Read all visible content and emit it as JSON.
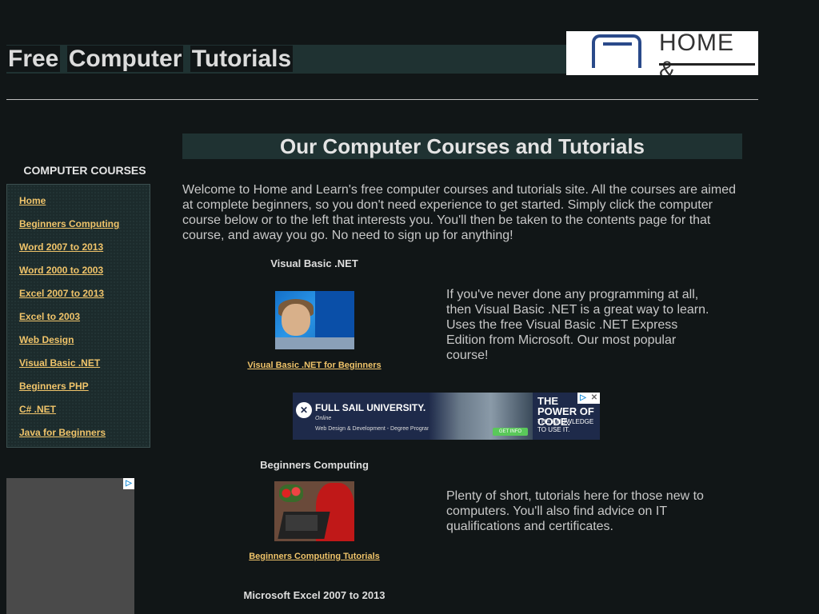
{
  "header": {
    "title_words": [
      "Free",
      "Computer",
      "Tutorials"
    ],
    "logo_text": "HOME &"
  },
  "sidebar": {
    "heading": "COMPUTER COURSES",
    "items": [
      {
        "label": "Home"
      },
      {
        "label": "Beginners Computing"
      },
      {
        "label": "Word 2007 to 2013"
      },
      {
        "label": "Word 2000 to 2003"
      },
      {
        "label": "Excel 2007 to 2013"
      },
      {
        "label": "Excel to 2003"
      },
      {
        "label": "Web Design"
      },
      {
        "label": "Visual Basic .NET"
      },
      {
        "label": "Beginners PHP"
      },
      {
        "label": "C# .NET"
      },
      {
        "label": "Java for Beginners"
      }
    ]
  },
  "main": {
    "heading": "Our Computer Courses and Tutorials",
    "intro": "Welcome to Home and Learn's free computer courses and tutorials site. All the courses are aimed at complete beginners, so you don't need experience to get started. Simply click the computer course below or to the left that interests you. You'll then be taken to the contents page for that course, and away you go. No need to sign up for anything!",
    "courses": [
      {
        "title": "Visual Basic .NET",
        "link": "Visual Basic .NET for Beginners",
        "description": "If you've never done any programming at all, then Visual Basic .NET is a great way to learn. Uses the free Visual Basic .NET Express Edition from Microsoft. Our most popular course!"
      },
      {
        "title": "Beginners Computing",
        "link": "Beginners Computing Tutorials",
        "description": "Plenty of short, tutorials here for those new to computers. You'll also find advice on IT qualifications and certificates."
      },
      {
        "title": "Microsoft Excel 2007 to 2013"
      }
    ]
  },
  "ad_banner": {
    "brand": "FULL SAIL UNIVERSITY.",
    "online": "Online",
    "program": "Web Design & Development - Degree Program",
    "cta": "GET INFO",
    "headline": "THE POWER OF CODE.",
    "subline": "THE KNOWLEDGE TO USE IT.",
    "adchoices_icon": "adchoices-icon",
    "close_icon": "close-icon"
  }
}
